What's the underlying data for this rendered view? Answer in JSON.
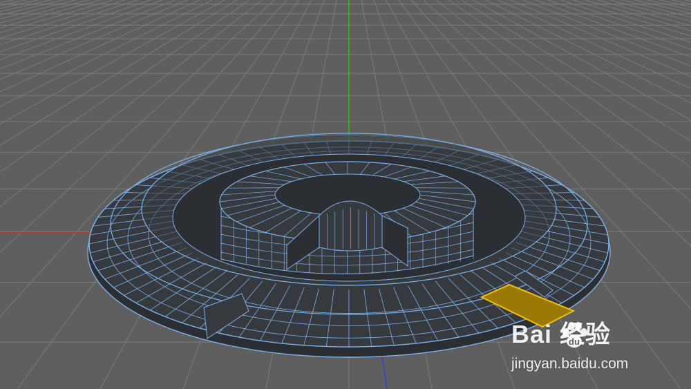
{
  "viewport": {
    "background": "#5f5f5f",
    "grid_color": "#7c7c7c",
    "mesh_fill": "#363a3e",
    "mesh_fill_dark": "#2b2e32",
    "wire_color": "#7fb3ec",
    "selected_polygon_fill": "#9a7a05",
    "selected_polygon_outline": "#f2c200",
    "axis_x_color": "#c83030",
    "axis_y_color": "#1fc21f",
    "axis_z_color": "#2f46c8"
  },
  "watermark": {
    "brand": "Bai  经验",
    "logo_icon": "paw-icon",
    "url": "jingyan.baidu.com"
  }
}
